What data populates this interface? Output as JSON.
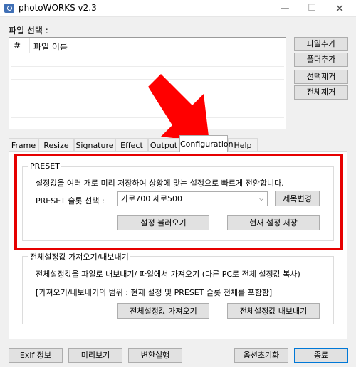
{
  "window": {
    "title": "photoWORKS v2.3",
    "min": "—",
    "max": "☐",
    "close": "✕"
  },
  "file_section": {
    "label": "파일 선택 :",
    "columns": [
      "#",
      "파일 이름"
    ],
    "buttons": {
      "add_file": "파일추가",
      "add_folder": "폴더추가",
      "remove_selected": "선택제거",
      "remove_all": "전체제거"
    }
  },
  "tabs": [
    "Frame",
    "Resize",
    "Signature",
    "Effect",
    "Output",
    "Configuration",
    "Help"
  ],
  "active_tab": "Configuration",
  "preset": {
    "title": "PRESET",
    "description": "설정값을 여러 개로 미리 저장하여 상황에 맞는 설정으로 빠르게 전환합니다.",
    "slot_label": "PRESET 슬롯 선택 :",
    "slot_value": "가로700 세로500",
    "rename_button": "제목변경",
    "load_button": "설정 불러오기",
    "save_button": "현재 설정 저장"
  },
  "import_export": {
    "title": "전체설정값 가져오기/내보내기",
    "line1": "전체설정값을 파일로 내보내기/ 파일에서 가져오기 (다른 PC로 전체 설정값 복사)",
    "line2": "[가져오기/내보내기의 범위 : 현재 설정 및 PRESET 슬롯 전체를 포함함]",
    "import_button": "전체설정값 가져오기",
    "export_button": "전체설정값 내보내기"
  },
  "bottom_buttons": {
    "exif": "Exif 정보",
    "preview": "미리보기",
    "convert": "변환실행",
    "reset": "옵션초기화",
    "exit": "종료"
  },
  "colors": {
    "highlight": "#e60000",
    "arrow": "#ff0000",
    "window_bg": "#f0f0f0"
  }
}
